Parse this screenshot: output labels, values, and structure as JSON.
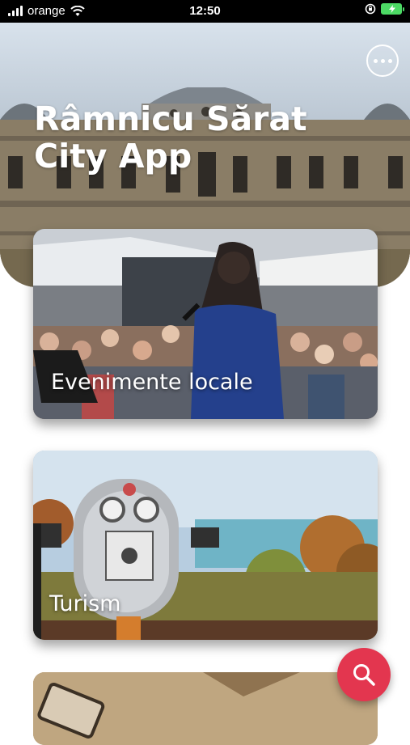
{
  "status_bar": {
    "carrier": "orange",
    "time": "12:50"
  },
  "header": {
    "title": "Râmnicu Sărat City App",
    "more_icon": "more-horizontal-icon"
  },
  "cards": [
    {
      "label": "Evenimente locale"
    },
    {
      "label": "Turism"
    },
    {
      "label": ""
    }
  ],
  "fab": {
    "icon": "search-icon",
    "color": "#e3364f"
  }
}
